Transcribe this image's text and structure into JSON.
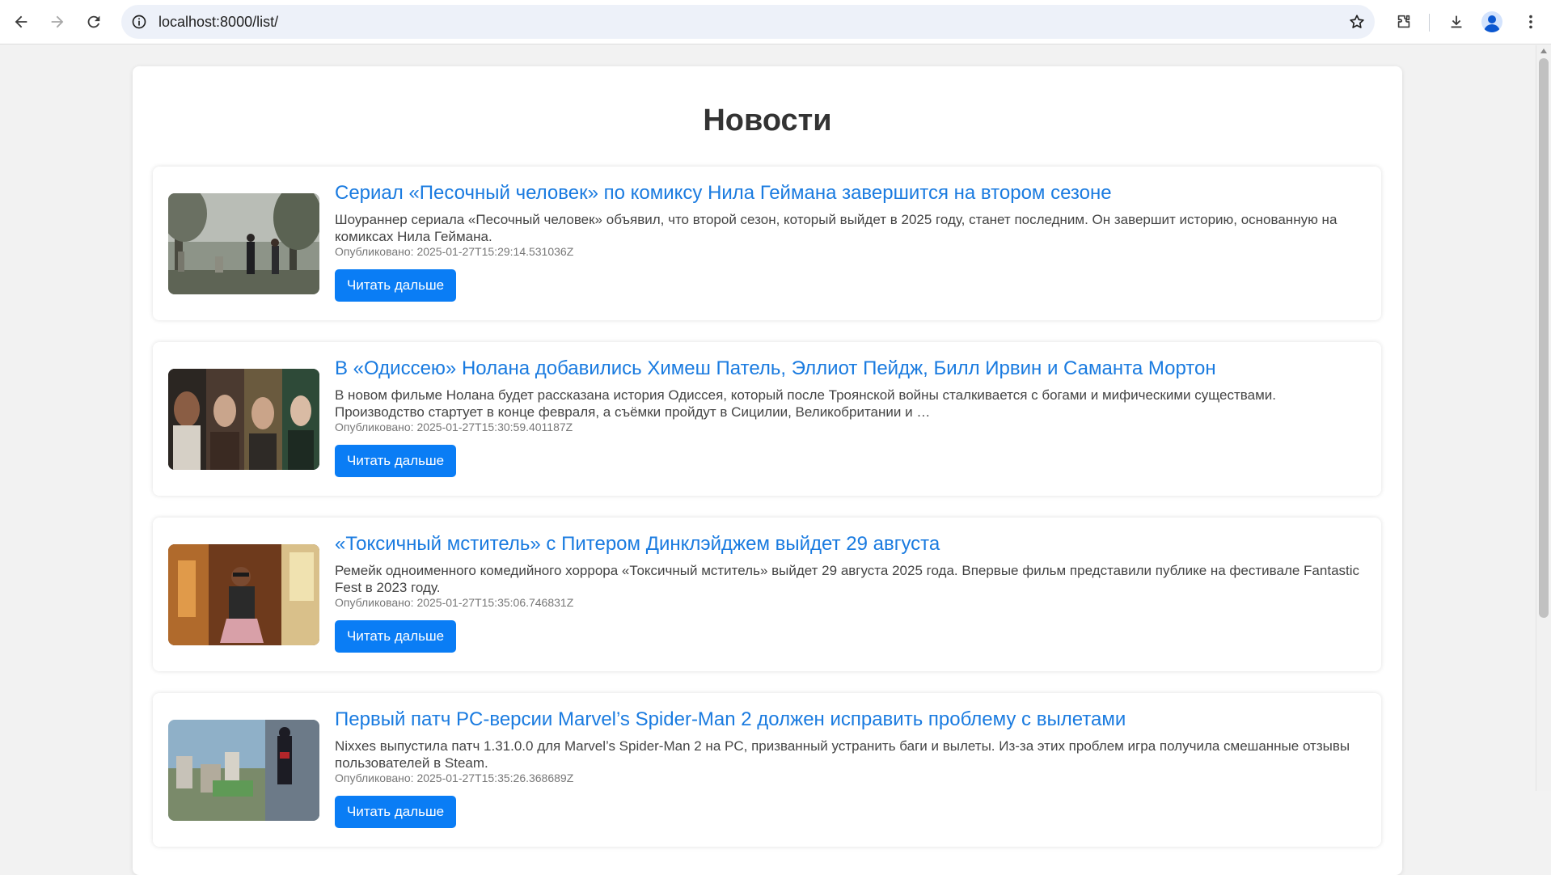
{
  "browser": {
    "url": "localhost:8000/list/"
  },
  "page": {
    "title": "Новости",
    "read_more_label": "Читать дальше"
  },
  "news": [
    {
      "title": "Сериал «Песочный человек» по комиксу Нила Геймана завершится на втором сезоне",
      "text": "Шоураннер сериала «Песочный человек» объявил, что второй сезон, который выйдет в 2025 году, станет последним. Он завершит историю, основанную на комиксах Нила Геймана.",
      "date": "Опубликовано: 2025-01-27T15:29:14.531036Z"
    },
    {
      "title": "В «Одиссею» Нолана добавились Химеш Патель, Эллиот Пейдж, Билл Ирвин и Саманта Мортон",
      "text": "В новом фильме Нолана будет рассказана история Одиссея, который после Троянской войны сталкивается с богами и мифическими существами. Производство стартует в конце февраля, а съёмки пройдут в Сицилии, Великобритании и …",
      "date": "Опубликовано: 2025-01-27T15:30:59.401187Z"
    },
    {
      "title": "«Токсичный мститель» с Питером Динклэйджем выйдет 29 августа",
      "text": "Ремейк одноименного комедийного хоррора «Токсичный мститель» выйдет 29 августа 2025 года. Впервые фильм представили публике на фестивале Fantastic Fest в 2023 году.",
      "date": "Опубликовано: 2025-01-27T15:35:06.746831Z"
    },
    {
      "title": "Первый патч PC-версии Marvel’s Spider-Man 2 должен исправить проблему с вылетами",
      "text": "Nixxes выпустила патч 1.31.0.0 для Marvel’s Spider-Man 2 на PC, призванный устранить баги и вылеты. Из-за этих проблем игра получила смешанные отзывы пользователей в Steam.",
      "date": "Опубликовано: 2025-01-27T15:35:26.368689Z"
    }
  ],
  "colors": {
    "link": "#1a7be0",
    "button": "#0a7df5",
    "background": "#f2f2f2"
  },
  "icons": [
    "back-arrow-icon",
    "forward-arrow-icon",
    "reload-icon",
    "site-info-icon",
    "bookmark-star-icon",
    "extensions-icon",
    "downloads-icon",
    "profile-avatar-icon",
    "kebab-menu-icon"
  ]
}
